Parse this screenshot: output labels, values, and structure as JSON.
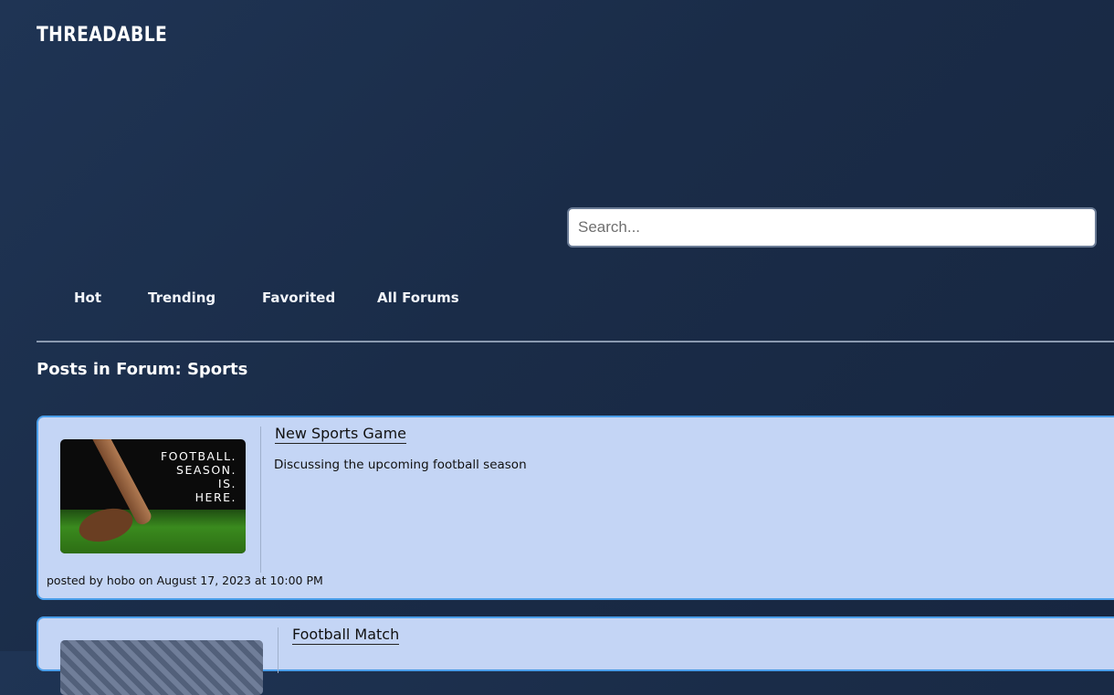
{
  "header": {
    "logo": "THREADABLE"
  },
  "search": {
    "placeholder": "Search...",
    "value": ""
  },
  "nav": {
    "items": [
      {
        "label": "Hot"
      },
      {
        "label": "Trending"
      },
      {
        "label": "Favorited"
      },
      {
        "label": "All Forums"
      }
    ]
  },
  "forum": {
    "heading": "Posts in Forum: Sports"
  },
  "posts": [
    {
      "title": "New Sports Game",
      "description": "Discussing the upcoming football season",
      "meta": "posted by hobo on August 17, 2023 at 10:00 PM",
      "thumbnail_text": [
        "FOOTBALL.",
        "SEASON.",
        "IS.",
        "HERE."
      ]
    },
    {
      "title": "Football Match"
    }
  ],
  "colors": {
    "background": "#1a2c48",
    "card_background": "#c4d5f5",
    "card_border": "#4a9eea",
    "divider": "#8b9ab0"
  }
}
